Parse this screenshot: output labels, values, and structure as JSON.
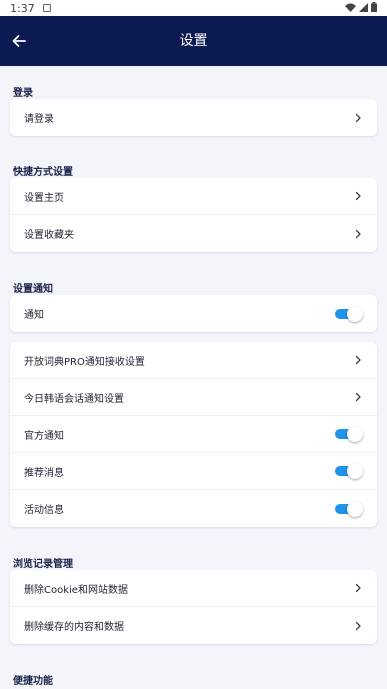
{
  "status_bar": {
    "time": "1:37"
  },
  "header": {
    "title": "设置"
  },
  "sections": {
    "login": {
      "title": "登录",
      "items": [
        "请登录"
      ]
    },
    "shortcut": {
      "title": "快捷方式设置",
      "items": [
        "设置主页",
        "设置收藏夹"
      ]
    },
    "notify": {
      "title": "设置通知",
      "main_toggle": "通知",
      "items": [
        "开放词典PRO通知接收设置",
        "今日韩语会话通知设置",
        "官方通知",
        "推荐消息",
        "活动信息"
      ]
    },
    "history": {
      "title": "浏览记录管理",
      "items": [
        "删除Cookie和网站数据",
        "删除缓存的内容和数据"
      ]
    },
    "quick": {
      "title": "便捷功能"
    }
  },
  "toggles": {
    "notify": true,
    "official": true,
    "recommend": true,
    "activity": true
  },
  "colors": {
    "app_bar": "#0c1a52",
    "toggle_on": "#1e93e8",
    "background": "#f3f5fb"
  }
}
